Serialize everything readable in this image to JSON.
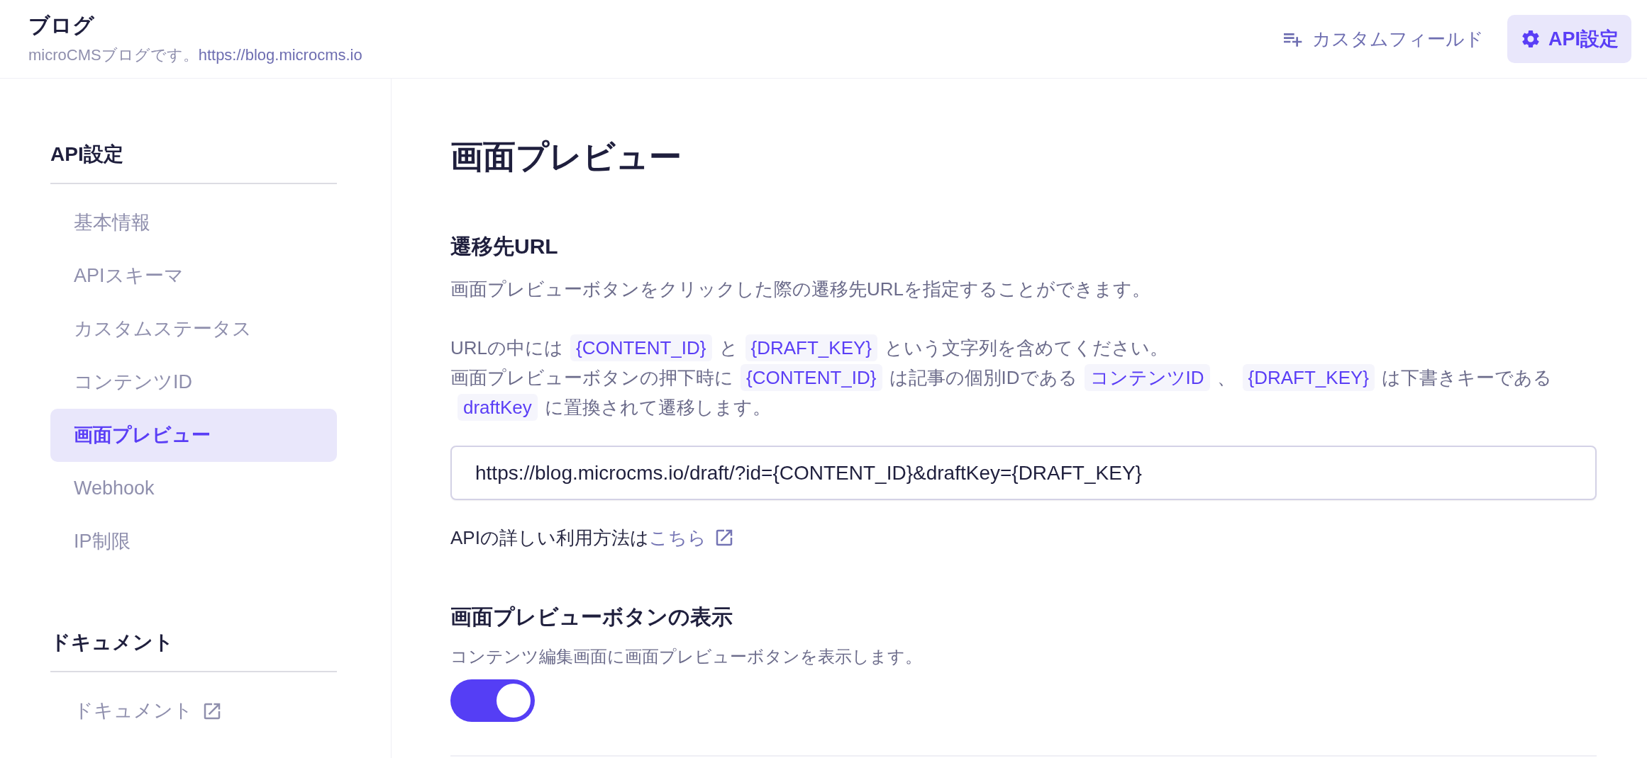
{
  "header": {
    "title": "ブログ",
    "description": "microCMSブログです。",
    "url": "https://blog.microcms.io",
    "actions": [
      {
        "kind": "fields",
        "label": "カスタムフィールド",
        "selected": false
      },
      {
        "kind": "settings",
        "label": "API設定",
        "selected": true
      }
    ]
  },
  "sidebar": {
    "sections": [
      {
        "heading": "API設定",
        "items": [
          {
            "label": "基本情報",
            "selected": false,
            "external": false
          },
          {
            "label": "APIスキーマ",
            "selected": false,
            "external": false
          },
          {
            "label": "カスタムステータス",
            "selected": false,
            "external": false
          },
          {
            "label": "コンテンツID",
            "selected": false,
            "external": false
          },
          {
            "label": "画面プレビュー",
            "selected": true,
            "external": false
          },
          {
            "label": "Webhook",
            "selected": false,
            "external": false
          },
          {
            "label": "IP制限",
            "selected": false,
            "external": false
          }
        ]
      },
      {
        "heading": "ドキュメント",
        "items": [
          {
            "label": "ドキュメント",
            "selected": false,
            "external": true
          }
        ]
      }
    ]
  },
  "main": {
    "title": "画面プレビュー",
    "sections": [
      {
        "heading": "遷移先URL",
        "description": "画面プレビューボタンをクリックした際の遷移先URLを指定することができます。",
        "paragraphs": [
          [
            {
              "kind": "text",
              "text": "URLの中には"
            },
            {
              "kind": "code",
              "text": "{CONTENT_ID}"
            },
            {
              "kind": "text",
              "text": "と"
            },
            {
              "kind": "code",
              "text": "{DRAFT_KEY}"
            },
            {
              "kind": "text",
              "text": "という文字列を含めてください。"
            }
          ],
          [
            {
              "kind": "text",
              "text": "画面プレビューボタンの押下時に"
            },
            {
              "kind": "code",
              "text": "{CONTENT_ID}"
            },
            {
              "kind": "text",
              "text": "は記事の個別IDである"
            },
            {
              "kind": "code",
              "text": "コンテンツID"
            },
            {
              "kind": "text",
              "text": "、"
            },
            {
              "kind": "code",
              "text": "{DRAFT_KEY}"
            },
            {
              "kind": "text",
              "text": "は下書きキーである"
            },
            {
              "kind": "code",
              "text": "draftKey"
            },
            {
              "kind": "text",
              "text": "に置換されて遷移します。"
            }
          ]
        ],
        "url_input": {
          "value": "https://blog.microcms.io/draft/?id={CONTENT_ID}&draftKey={DRAFT_KEY}"
        },
        "help": {
          "text": "APIの詳しい利用方法は",
          "link": "こちら"
        }
      },
      {
        "heading": "画面プレビューボタンの表示",
        "description": "コンテンツ編集画面に画面プレビューボタンを表示します。",
        "toggle": {
          "on": true
        }
      }
    ]
  }
}
